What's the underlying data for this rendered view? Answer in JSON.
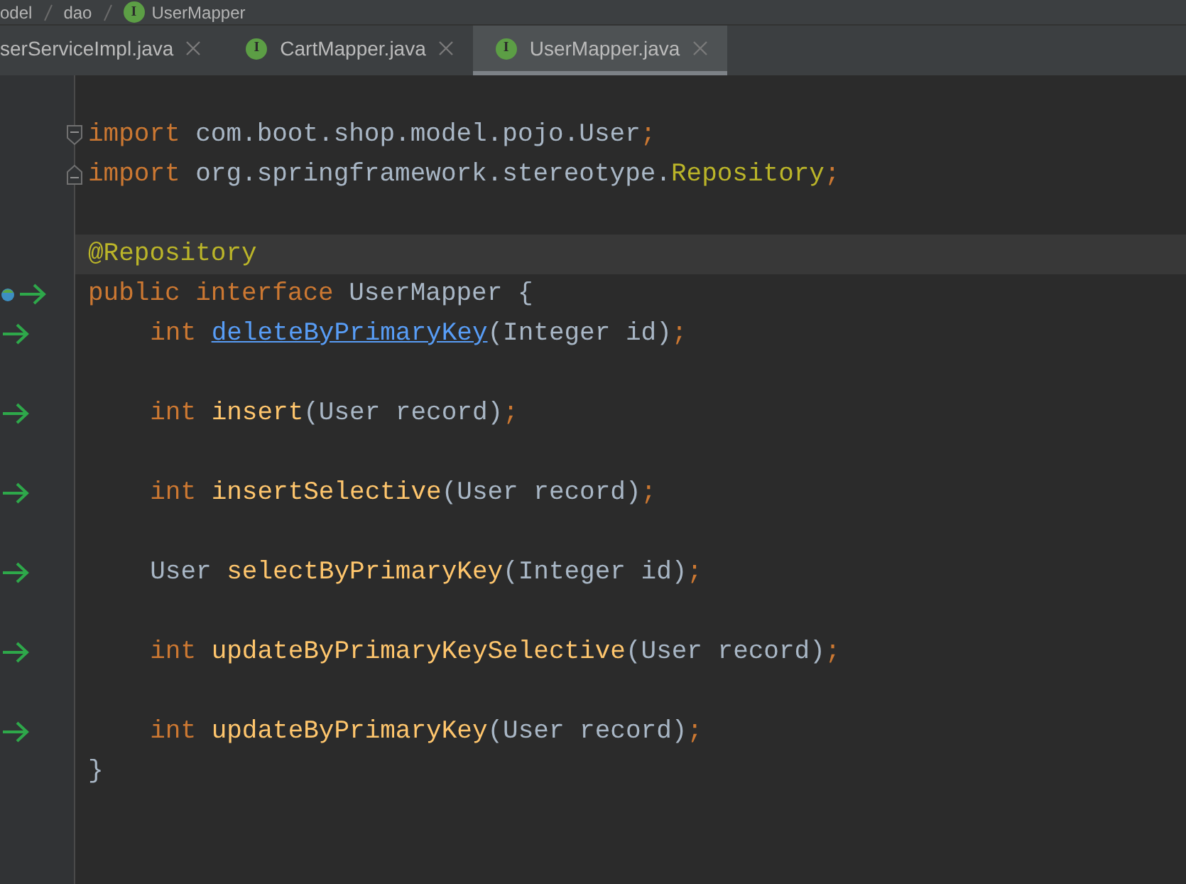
{
  "breadcrumb": [
    {
      "label": "odel"
    },
    {
      "label": "dao"
    },
    {
      "label": "UserMapper",
      "badge": "I"
    }
  ],
  "tabs": [
    {
      "label": "serServiceImpl.java",
      "selected": false
    },
    {
      "label": "CartMapper.java",
      "badge": "I",
      "selected": false
    },
    {
      "label": "UserMapper.java",
      "badge": "I",
      "selected": true
    }
  ],
  "lines": [
    {
      "kind": "blank",
      "current": false,
      "gutter_arrow": false,
      "gutter_badge": false
    },
    {
      "kind": "fold_group",
      "expanded": true,
      "children": [
        {
          "kind": "code",
          "current": false,
          "gutter_arrow": false,
          "gutter_badge": false,
          "tokens": [
            {
              "text": "import",
              "kind": "keyword"
            },
            {
              "text": " com.boot.shop.model.pojo.User",
              "kind": "plain"
            },
            {
              "text": ";",
              "kind": "keyword"
            }
          ]
        },
        {
          "kind": "code",
          "current": false,
          "gutter_arrow": false,
          "gutter_badge": false,
          "tokens": [
            {
              "text": "import",
              "kind": "keyword"
            },
            {
              "text": " org.springframework.stereotype.",
              "kind": "plain"
            },
            {
              "text": "Repository",
              "kind": "annotation"
            },
            {
              "text": ";",
              "kind": "keyword"
            }
          ]
        }
      ]
    },
    {
      "kind": "blank",
      "current": false,
      "gutter_arrow": false,
      "gutter_badge": false
    },
    {
      "kind": "code",
      "current": true,
      "gutter_arrow": false,
      "gutter_badge": false,
      "tokens": [
        {
          "text": "@Repository",
          "kind": "annotation"
        }
      ]
    },
    {
      "kind": "code",
      "current": false,
      "gutter_arrow": true,
      "gutter_badge": true,
      "tokens": [
        {
          "text": "public interface",
          "kind": "keyword"
        },
        {
          "text": " UserMapper {",
          "kind": "plain"
        }
      ],
      "children": [
        {
          "kind": "code",
          "current": false,
          "gutter_arrow": true,
          "gutter_badge": false,
          "tokens": [
            {
              "text": "int ",
              "kind": "keyword"
            },
            {
              "text": "deleteByPrimaryKey",
              "kind": "link"
            },
            {
              "text": "(Integer id)",
              "kind": "plain"
            },
            {
              "text": ";",
              "kind": "keyword"
            }
          ]
        },
        {
          "kind": "blank",
          "current": false,
          "gutter_arrow": false,
          "gutter_badge": false
        },
        {
          "kind": "code",
          "current": false,
          "gutter_arrow": true,
          "gutter_badge": false,
          "tokens": [
            {
              "text": "int ",
              "kind": "keyword"
            },
            {
              "text": "insert",
              "kind": "method"
            },
            {
              "text": "(User record)",
              "kind": "plain"
            },
            {
              "text": ";",
              "kind": "keyword"
            }
          ]
        },
        {
          "kind": "blank",
          "current": false,
          "gutter_arrow": false,
          "gutter_badge": false
        },
        {
          "kind": "code",
          "current": false,
          "gutter_arrow": true,
          "gutter_badge": false,
          "tokens": [
            {
              "text": "int ",
              "kind": "keyword"
            },
            {
              "text": "insertSelective",
              "kind": "method"
            },
            {
              "text": "(User record)",
              "kind": "plain"
            },
            {
              "text": ";",
              "kind": "keyword"
            }
          ]
        },
        {
          "kind": "blank",
          "current": false,
          "gutter_arrow": false,
          "gutter_badge": false
        },
        {
          "kind": "code",
          "current": false,
          "gutter_arrow": true,
          "gutter_badge": false,
          "tokens": [
            {
              "text": "User ",
              "kind": "plain"
            },
            {
              "text": "selectByPrimaryKey",
              "kind": "method"
            },
            {
              "text": "(Integer id)",
              "kind": "plain"
            },
            {
              "text": ";",
              "kind": "keyword"
            }
          ]
        },
        {
          "kind": "blank",
          "current": false,
          "gutter_arrow": false,
          "gutter_badge": false
        },
        {
          "kind": "code",
          "current": false,
          "gutter_arrow": true,
          "gutter_badge": false,
          "tokens": [
            {
              "text": "int ",
              "kind": "keyword"
            },
            {
              "text": "updateByPrimaryKeySelective",
              "kind": "method"
            },
            {
              "text": "(User record)",
              "kind": "plain"
            },
            {
              "text": ";",
              "kind": "keyword"
            }
          ]
        },
        {
          "kind": "blank",
          "current": false,
          "gutter_arrow": false,
          "gutter_badge": false
        },
        {
          "kind": "code",
          "current": false,
          "gutter_arrow": true,
          "gutter_badge": false,
          "tokens": [
            {
              "text": "int ",
              "kind": "keyword"
            },
            {
              "text": "updateByPrimaryKey",
              "kind": "method"
            },
            {
              "text": "(User record)",
              "kind": "plain"
            },
            {
              "text": ";",
              "kind": "keyword"
            }
          ]
        }
      ]
    },
    {
      "kind": "code",
      "current": false,
      "gutter_arrow": false,
      "gutter_badge": false,
      "tokens": [
        {
          "text": "}",
          "kind": "plain"
        }
      ]
    }
  ]
}
